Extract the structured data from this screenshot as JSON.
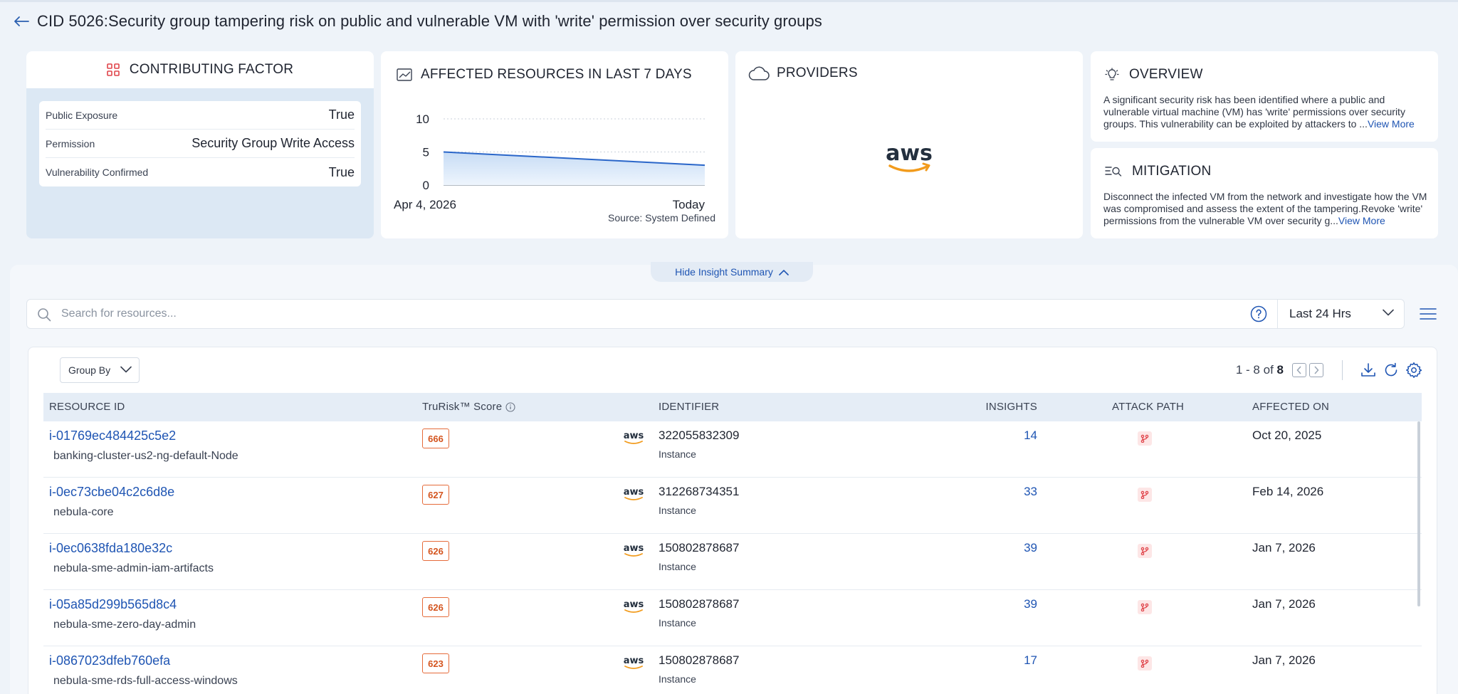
{
  "page": {
    "title": "CID 5026:Security group tampering risk on public and vulnerable VM with 'write' permission over security groups"
  },
  "contributing_factor": {
    "title": "CONTRIBUTING FACTOR",
    "rows": [
      {
        "label": "Public Exposure",
        "value": "True"
      },
      {
        "label": "Permission",
        "value": "Security Group Write Access"
      },
      {
        "label": "Vulnerability Confirmed",
        "value": "True"
      }
    ]
  },
  "affected_chart": {
    "title": "AFFECTED RESOURCES IN LAST 7 DAYS",
    "source": "Source: System Defined"
  },
  "chart_data": {
    "type": "area",
    "title": "AFFECTED RESOURCES IN LAST 7 DAYS",
    "x_tick_labels": [
      "Apr 4, 2026",
      "Today"
    ],
    "x": [
      0,
      1
    ],
    "values": [
      5,
      3
    ],
    "yticks": [
      0,
      5,
      10
    ],
    "ylim": [
      0,
      10
    ],
    "grid": true,
    "series_color": "#2a66c9"
  },
  "providers": {
    "title": "PROVIDERS",
    "logo": "aws"
  },
  "overview": {
    "title": "OVERVIEW",
    "text": "A significant security risk has been identified where a public and vulnerable virtual machine (VM) has 'write' permissions over security groups. This vulnerability can be exploited by attackers to ...",
    "view_more": "View More"
  },
  "mitigation": {
    "title": "MITIGATION",
    "text": "Disconnect the infected VM from the network and investigate how the VM was compromised and assess the extent of the tampering.Revoke 'write' permissions from the vulnerable VM over security g...",
    "view_more": "View More"
  },
  "toggle": {
    "label": "Hide Insight Summary"
  },
  "search": {
    "placeholder": "Search for resources...",
    "value": ""
  },
  "time_range": {
    "selected": "Last 24 Hrs"
  },
  "table": {
    "group_by_label": "Group By",
    "pager": {
      "range": "1 - 8",
      "of": "of",
      "total": "8"
    },
    "columns": {
      "resource_id": "RESOURCE ID",
      "score": "TruRisk™ Score",
      "identifier": "IDENTIFIER",
      "insights": "INSIGHTS",
      "attack_path": "ATTACK PATH",
      "affected_on": "AFFECTED ON"
    },
    "rows": [
      {
        "id": "i-01769ec484425c5e2",
        "name": "banking-cluster-us2-ng-default-Node",
        "score": "666",
        "provider": "aws",
        "identifier": "322055832309",
        "type": "Instance",
        "insights": "14",
        "affected_on": "Oct 20, 2025"
      },
      {
        "id": "i-0ec73cbe04c2c6d8e",
        "name": "nebula-core",
        "score": "627",
        "provider": "aws",
        "identifier": "312268734351",
        "type": "Instance",
        "insights": "33",
        "affected_on": "Feb 14, 2026"
      },
      {
        "id": "i-0ec0638fda180e32c",
        "name": "nebula-sme-admin-iam-artifacts",
        "score": "626",
        "provider": "aws",
        "identifier": "150802878687",
        "type": "Instance",
        "insights": "39",
        "affected_on": "Jan 7, 2026"
      },
      {
        "id": "i-05a85d299b565d8c4",
        "name": "nebula-sme-zero-day-admin",
        "score": "626",
        "provider": "aws",
        "identifier": "150802878687",
        "type": "Instance",
        "insights": "39",
        "affected_on": "Jan 7, 2026"
      },
      {
        "id": "i-0867023dfeb760efa",
        "name": "nebula-sme-rds-full-access-windows",
        "score": "623",
        "provider": "aws",
        "identifier": "150802878687",
        "type": "Instance",
        "insights": "17",
        "affected_on": "Jan 7, 2026"
      }
    ]
  },
  "colors": {
    "accent": "#1f55b3",
    "score_orange": "#e56b3a",
    "attack_red": "#e0444a",
    "aws_orange": "#f29b1c"
  }
}
